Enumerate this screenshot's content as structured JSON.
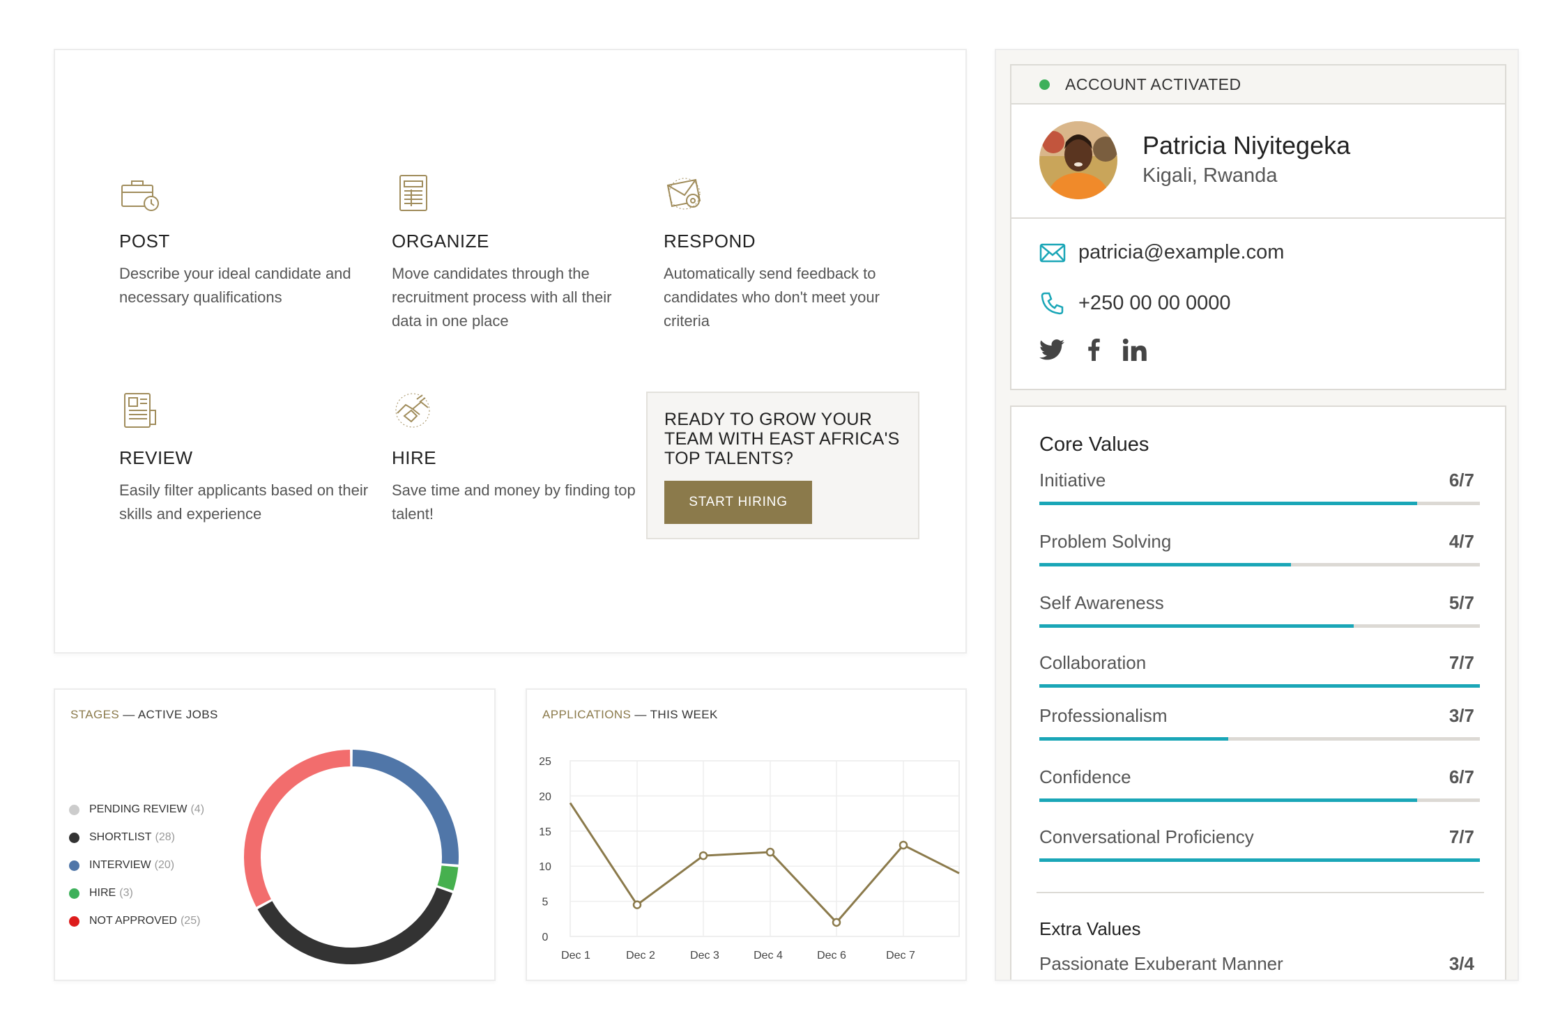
{
  "features": [
    {
      "title": "POST",
      "desc": "Describe your ideal candidate and necessary qualifications",
      "icon": "briefcase-clock-icon"
    },
    {
      "title": "ORGANIZE",
      "desc": "Move candidates through the recruitment process with all their data in one place",
      "icon": "document-list-icon"
    },
    {
      "title": "RESPOND",
      "desc": "Automatically send feedback to candidates who don't meet your criteria",
      "icon": "email-at-icon"
    },
    {
      "title": "REVIEW",
      "desc": "Easily filter applicants based on their skills and experience",
      "icon": "resume-icon"
    },
    {
      "title": "HIRE",
      "desc": "Save time and money by finding top talent!",
      "icon": "handshake-icon"
    }
  ],
  "cta": {
    "title": "READY TO GROW YOUR TEAM WITH EAST AFRICA'S TOP TALENTS?",
    "button": "START HIRING"
  },
  "stages": {
    "title_accent": "STAGES",
    "title_rest": " — ACTIVE JOBS",
    "legend": [
      {
        "label": "PENDING REVIEW",
        "count": "(4)",
        "color": "#cccccc"
      },
      {
        "label": "SHORTLIST",
        "count": "(28)",
        "color": "#333333"
      },
      {
        "label": "INTERVIEW",
        "count": "(20)",
        "color": "#5076a8"
      },
      {
        "label": "HIRE",
        "count": "(3)",
        "color": "#3db05a"
      },
      {
        "label": "NOT APPROVED",
        "count": "(25)",
        "color": "#dd1c1c"
      }
    ]
  },
  "applications": {
    "title_accent": "APPLICATIONS",
    "title_rest": " — THIS WEEK"
  },
  "chart_data": [
    {
      "type": "pie",
      "donut": true,
      "slices": [
        {
          "label": "INTERVIEW",
          "value": 20,
          "color": "#5076a8"
        },
        {
          "label": "HIRE",
          "value": 3,
          "color": "#46b04e"
        },
        {
          "label": "SHORTLIST",
          "value": 28,
          "color": "#333333"
        },
        {
          "label": "NOT APPROVED",
          "value": 25,
          "color": "#f26d6d"
        }
      ]
    },
    {
      "type": "line",
      "x": [
        "Dec 1",
        "Dec 2",
        "Dec 3",
        "Dec 4",
        "Dec 6",
        "Dec 7"
      ],
      "y": [
        19,
        4.5,
        11.5,
        12,
        2,
        13
      ],
      "x_end": 9,
      "yticks": [
        0,
        5,
        10,
        15,
        20,
        25
      ],
      "ylim": [
        0,
        25
      ],
      "grid": true,
      "color": "#8b7a4b"
    }
  ],
  "profile": {
    "status": "ACCOUNT ACTIVATED",
    "name": "Patricia Niyitegeka",
    "location": "Kigali, Rwanda",
    "email": "patricia@example.com",
    "phone": "+250 00 00 0000"
  },
  "values": {
    "core_title": "Core Values",
    "core": [
      {
        "label": "Initiative",
        "score": "6/7",
        "fraction": 0.857
      },
      {
        "label": "Problem Solving",
        "score": "4/7",
        "fraction": 0.571
      },
      {
        "label": "Self Awareness",
        "score": "5/7",
        "fraction": 0.714
      },
      {
        "label": "Collaboration",
        "score": "7/7",
        "fraction": 1.0
      },
      {
        "label": "Professionalism",
        "score": "3/7",
        "fraction": 0.429
      },
      {
        "label": "Confidence",
        "score": "6/7",
        "fraction": 0.857
      },
      {
        "label": "Conversational Proficiency",
        "score": "7/7",
        "fraction": 1.0
      }
    ],
    "extra_title": "Extra Values",
    "extra": [
      {
        "label": "Passionate Exuberant Manner",
        "score": "3/4"
      }
    ]
  }
}
